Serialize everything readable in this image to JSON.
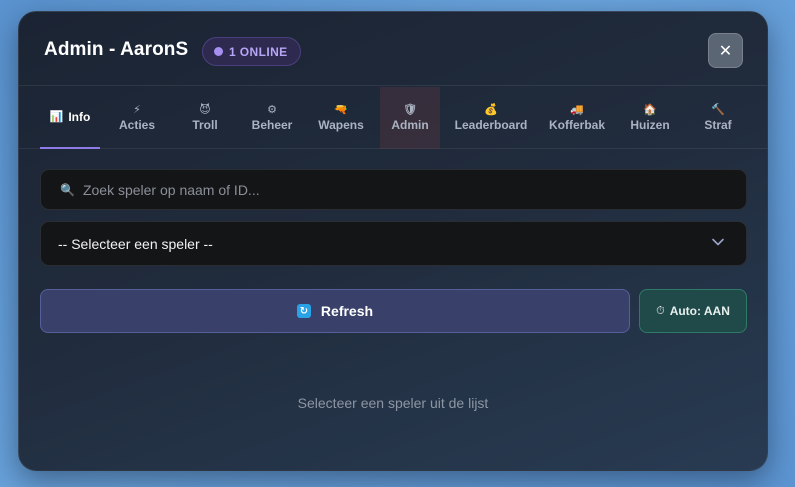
{
  "window": {
    "title": "Admin - AaronS",
    "badge": "1 ONLINE",
    "close_label": "✕"
  },
  "tabs": [
    {
      "label": "Info",
      "icon": "📊",
      "icon_name": "chart-icon",
      "active": true
    },
    {
      "label": "Acties",
      "icon": "⚡",
      "icon_name": "lightning-icon"
    },
    {
      "label": "Troll",
      "icon": "😈",
      "icon_name": "troll-face-icon"
    },
    {
      "label": "Beheer",
      "icon": "⚙",
      "icon_name": "gear-icon"
    },
    {
      "label": "Wapens",
      "icon": "🔫",
      "icon_name": "gun-icon"
    },
    {
      "label": "Admin",
      "icon": "🛡",
      "icon_name": "shield-icon"
    },
    {
      "label": "Leaderboard",
      "icon": "💰",
      "icon_name": "money-bag-icon"
    },
    {
      "label": "Kofferbak",
      "icon": "🚚",
      "icon_name": "truck-icon"
    },
    {
      "label": "Huizen",
      "icon": "🏠",
      "icon_name": "house-icon"
    },
    {
      "label": "Straf",
      "icon": "🔨",
      "icon_name": "hammer-icon"
    }
  ],
  "search": {
    "icon": "🔍",
    "placeholder": "Zoek speler op naam of ID..."
  },
  "player_select": {
    "selected": "-- Selecteer een speler --"
  },
  "actions": {
    "refresh_label": "Refresh",
    "refresh_icon": "↻",
    "auto_icon": "⏱",
    "auto_label": "Auto: AAN"
  },
  "empty_state": "Selecteer een speler uit de lijst",
  "colors": {
    "accent": "#8f7be8",
    "online_badge": "#b7a6f5",
    "refresh_bg": "#39406a",
    "auto_bg": "#1f4a49"
  }
}
